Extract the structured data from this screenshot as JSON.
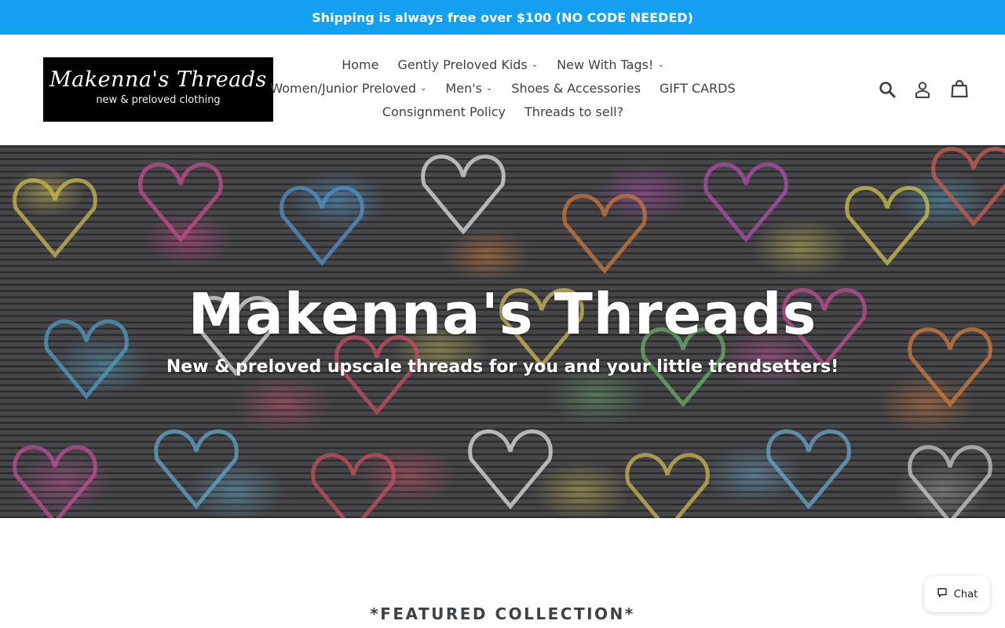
{
  "announcement": "Shipping is always free over $100 (NO CODE NEEDED)",
  "logo": {
    "line1": "Makenna's Threads",
    "line2": "new & preloved clothing"
  },
  "nav": {
    "row1": [
      {
        "label": "Home",
        "dropdown": false
      },
      {
        "label": "Gently Preloved Kids",
        "dropdown": true
      },
      {
        "label": "New With Tags!",
        "dropdown": true
      }
    ],
    "row2": [
      {
        "label": "Women/Junior Preloved",
        "dropdown": true
      },
      {
        "label": "Men's",
        "dropdown": true
      },
      {
        "label": "Shoes & Accessories",
        "dropdown": false
      },
      {
        "label": "GIFT CARDS",
        "dropdown": false
      }
    ],
    "row3": [
      {
        "label": "Consignment Policy",
        "dropdown": false
      },
      {
        "label": "Threads to sell?",
        "dropdown": false
      }
    ],
    "caret": "⌄"
  },
  "header_icons": [
    "search-icon",
    "account-icon",
    "cart-icon"
  ],
  "hero": {
    "title": "Makenna's Threads",
    "subtitle": "New & preloved upscale threads for you and your little trendsetters!"
  },
  "featured_heading": "*FEATURED COLLECTION*",
  "chat": {
    "label": "Chat"
  },
  "colors": {
    "announcement_bg": "#14a0f0",
    "text": "#3d4246",
    "logo_bg": "#000000"
  }
}
